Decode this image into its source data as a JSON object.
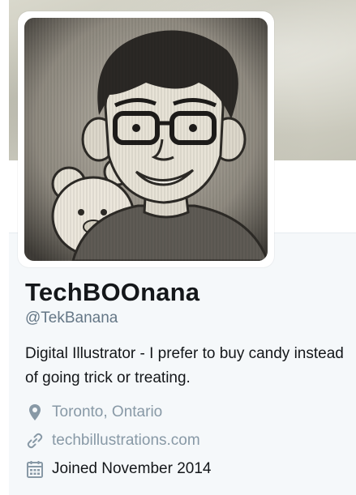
{
  "profile": {
    "display_name": "TechBOOnana",
    "handle": "@TekBanana",
    "bio": "Digital Illustrator - I prefer to buy candy instead of going trick or treating.",
    "location": "Toronto, Ontario",
    "website": "techbillustrations.com",
    "joined": "Joined November 2014"
  },
  "icons": {
    "location": "map-pin-icon",
    "website": "link-icon",
    "joined": "calendar-icon"
  },
  "colors": {
    "name_text": "#14171a",
    "secondary_text": "#657786",
    "muted_text": "#8899a6",
    "card_background": "#f5f8fa"
  }
}
